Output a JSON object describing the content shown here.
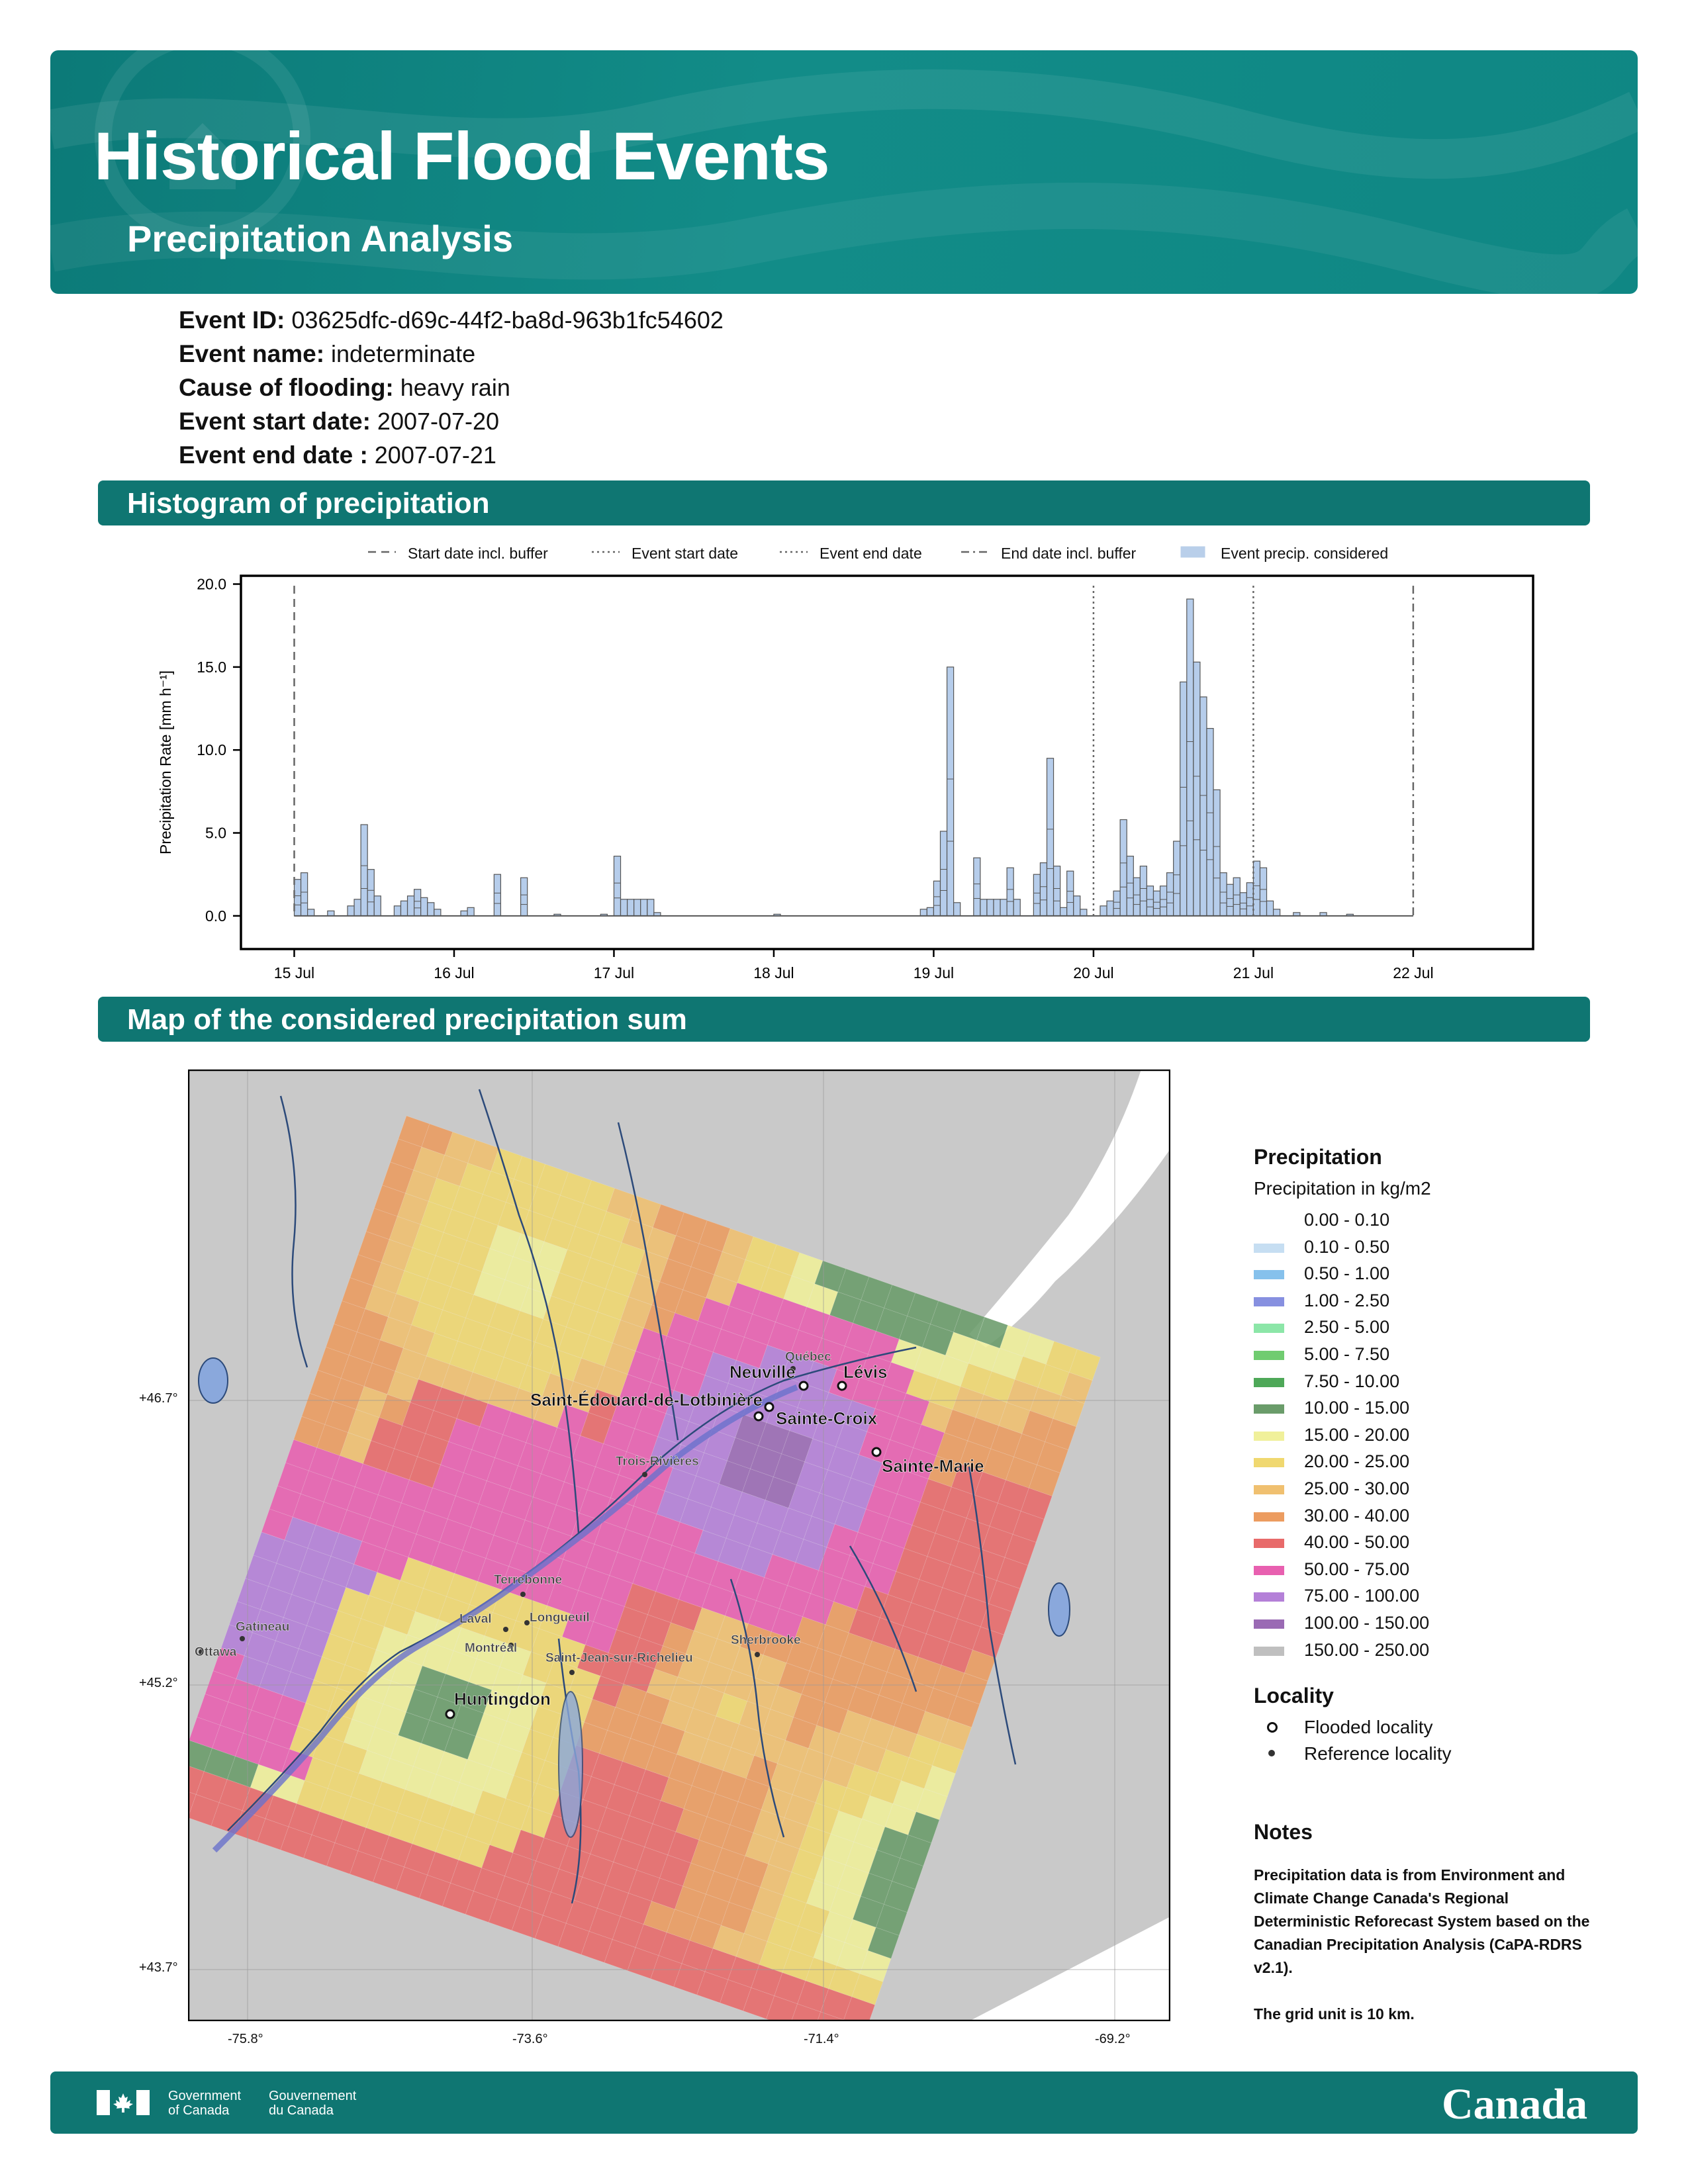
{
  "header": {
    "title": "Historical Flood Events",
    "subtitle": "Precipitation Analysis"
  },
  "event": {
    "id_label": "Event ID:",
    "id": "03625dfc-d69c-44f2-ba8d-963b1fc54602",
    "name_label": "Event name:",
    "name": "indeterminate",
    "cause_label": "Cause of flooding:",
    "cause": "heavy rain",
    "start_label": "Event start date:",
    "start": "2007-07-20",
    "end_label": "Event end date :",
    "end": "2007-07-21"
  },
  "sections": {
    "histogram": "Histogram of precipitation",
    "map": "Map of the considered precipitation sum"
  },
  "chart_data": {
    "type": "bar",
    "ylabel": "Precipitation Rate [mm h⁻¹]",
    "ylim": [
      -2,
      20.5
    ],
    "yticks": [
      "0.0",
      "5.0",
      "10.0",
      "15.0",
      "20.0"
    ],
    "xlim": [
      "2007-07-14T16:00",
      "2007-07-22T18:00"
    ],
    "xticks": [
      {
        "t": "2007-07-15T00:00",
        "label": "15 Jul"
      },
      {
        "t": "2007-07-16T00:00",
        "label": "16 Jul"
      },
      {
        "t": "2007-07-17T00:00",
        "label": "17 Jul"
      },
      {
        "t": "2007-07-18T00:00",
        "label": "18 Jul"
      },
      {
        "t": "2007-07-19T00:00",
        "label": "19 Jul"
      },
      {
        "t": "2007-07-20T00:00",
        "label": "20 Jul"
      },
      {
        "t": "2007-07-21T00:00",
        "label": "21 Jul"
      },
      {
        "t": "2007-07-22T00:00",
        "label": "22 Jul"
      }
    ],
    "legend": {
      "placement": "top",
      "entries": [
        {
          "label": "Start date incl. buffer",
          "style": "dashed"
        },
        {
          "label": "Event start date",
          "style": "dotted"
        },
        {
          "label": "Event end date",
          "style": "dotted"
        },
        {
          "label": "End date incl. buffer",
          "style": "dashdot"
        },
        {
          "label": "Event precip. considered",
          "style": "fill"
        }
      ]
    },
    "vlines": [
      {
        "t": "2007-07-15T00:00",
        "style": "dashed"
      },
      {
        "t": "2007-07-20T00:00",
        "style": "dotted"
      },
      {
        "t": "2007-07-21T00:00",
        "style": "dotted"
      },
      {
        "t": "2007-07-22T00:00",
        "style": "dashdot"
      }
    ],
    "bars": [
      {
        "t": "2007-07-15T00:00",
        "v": 2.2
      },
      {
        "t": "2007-07-15T01:00",
        "v": 2.6
      },
      {
        "t": "2007-07-15T02:00",
        "v": 0.4
      },
      {
        "t": "2007-07-15T05:00",
        "v": 0.3
      },
      {
        "t": "2007-07-15T08:00",
        "v": 0.6
      },
      {
        "t": "2007-07-15T09:00",
        "v": 1.0
      },
      {
        "t": "2007-07-15T10:00",
        "v": 5.5
      },
      {
        "t": "2007-07-15T11:00",
        "v": 2.8
      },
      {
        "t": "2007-07-15T12:00",
        "v": 1.2
      },
      {
        "t": "2007-07-15T15:00",
        "v": 0.6
      },
      {
        "t": "2007-07-15T16:00",
        "v": 0.9
      },
      {
        "t": "2007-07-15T17:00",
        "v": 1.2
      },
      {
        "t": "2007-07-15T18:00",
        "v": 1.6
      },
      {
        "t": "2007-07-15T19:00",
        "v": 1.1
      },
      {
        "t": "2007-07-15T20:00",
        "v": 0.8
      },
      {
        "t": "2007-07-15T21:00",
        "v": 0.4
      },
      {
        "t": "2007-07-16T01:00",
        "v": 0.3
      },
      {
        "t": "2007-07-16T02:00",
        "v": 0.5
      },
      {
        "t": "2007-07-16T06:00",
        "v": 2.5
      },
      {
        "t": "2007-07-16T10:00",
        "v": 2.3
      },
      {
        "t": "2007-07-16T15:00",
        "v": 0.1
      },
      {
        "t": "2007-07-16T22:00",
        "v": 0.1
      },
      {
        "t": "2007-07-17T00:00",
        "v": 3.6
      },
      {
        "t": "2007-07-17T01:00",
        "v": 1.0
      },
      {
        "t": "2007-07-17T02:00",
        "v": 1.0
      },
      {
        "t": "2007-07-17T03:00",
        "v": 1.0
      },
      {
        "t": "2007-07-17T04:00",
        "v": 1.0
      },
      {
        "t": "2007-07-17T05:00",
        "v": 1.0
      },
      {
        "t": "2007-07-17T06:00",
        "v": 0.2
      },
      {
        "t": "2007-07-18T00:00",
        "v": 0.1
      },
      {
        "t": "2007-07-18T22:00",
        "v": 0.4
      },
      {
        "t": "2007-07-18T23:00",
        "v": 0.5
      },
      {
        "t": "2007-07-19T00:00",
        "v": 2.1
      },
      {
        "t": "2007-07-19T01:00",
        "v": 5.1
      },
      {
        "t": "2007-07-19T02:00",
        "v": 15.0
      },
      {
        "t": "2007-07-19T03:00",
        "v": 0.8
      },
      {
        "t": "2007-07-19T06:00",
        "v": 3.5
      },
      {
        "t": "2007-07-19T07:00",
        "v": 1.0
      },
      {
        "t": "2007-07-19T08:00",
        "v": 1.0
      },
      {
        "t": "2007-07-19T09:00",
        "v": 1.0
      },
      {
        "t": "2007-07-19T10:00",
        "v": 1.0
      },
      {
        "t": "2007-07-19T11:00",
        "v": 2.9
      },
      {
        "t": "2007-07-19T12:00",
        "v": 1.0
      },
      {
        "t": "2007-07-19T15:00",
        "v": 2.5
      },
      {
        "t": "2007-07-19T16:00",
        "v": 3.2
      },
      {
        "t": "2007-07-19T17:00",
        "v": 9.5
      },
      {
        "t": "2007-07-19T18:00",
        "v": 3.0
      },
      {
        "t": "2007-07-19T19:00",
        "v": 0.5
      },
      {
        "t": "2007-07-19T20:00",
        "v": 2.7
      },
      {
        "t": "2007-07-19T21:00",
        "v": 1.2
      },
      {
        "t": "2007-07-19T22:00",
        "v": 0.4
      },
      {
        "t": "2007-07-20T01:00",
        "v": 0.6
      },
      {
        "t": "2007-07-20T02:00",
        "v": 0.9
      },
      {
        "t": "2007-07-20T03:00",
        "v": 1.5
      },
      {
        "t": "2007-07-20T04:00",
        "v": 5.8
      },
      {
        "t": "2007-07-20T05:00",
        "v": 3.6
      },
      {
        "t": "2007-07-20T06:00",
        "v": 2.3
      },
      {
        "t": "2007-07-20T07:00",
        "v": 3.0
      },
      {
        "t": "2007-07-20T08:00",
        "v": 1.8
      },
      {
        "t": "2007-07-20T09:00",
        "v": 1.5
      },
      {
        "t": "2007-07-20T10:00",
        "v": 1.8
      },
      {
        "t": "2007-07-20T11:00",
        "v": 2.6
      },
      {
        "t": "2007-07-20T12:00",
        "v": 4.5
      },
      {
        "t": "2007-07-20T13:00",
        "v": 14.1
      },
      {
        "t": "2007-07-20T14:00",
        "v": 19.1
      },
      {
        "t": "2007-07-20T15:00",
        "v": 15.3
      },
      {
        "t": "2007-07-20T16:00",
        "v": 13.2
      },
      {
        "t": "2007-07-20T17:00",
        "v": 11.3
      },
      {
        "t": "2007-07-20T18:00",
        "v": 7.6
      },
      {
        "t": "2007-07-20T19:00",
        "v": 2.6
      },
      {
        "t": "2007-07-20T20:00",
        "v": 1.9
      },
      {
        "t": "2007-07-20T21:00",
        "v": 2.3
      },
      {
        "t": "2007-07-20T22:00",
        "v": 1.4
      },
      {
        "t": "2007-07-20T23:00",
        "v": 2.0
      },
      {
        "t": "2007-07-21T00:00",
        "v": 3.3
      },
      {
        "t": "2007-07-21T01:00",
        "v": 2.9
      },
      {
        "t": "2007-07-21T02:00",
        "v": 0.9
      },
      {
        "t": "2007-07-21T03:00",
        "v": 0.4
      },
      {
        "t": "2007-07-21T06:00",
        "v": 0.2
      },
      {
        "t": "2007-07-21T10:00",
        "v": 0.2
      },
      {
        "t": "2007-07-21T14:00",
        "v": 0.1
      }
    ]
  },
  "map": {
    "lat_ticks": [
      "+46.7°",
      "+45.2°",
      "+43.7°"
    ],
    "lon_ticks": [
      "-75.8°",
      "-73.6°",
      "-71.4°",
      "-69.2°"
    ],
    "flooded": [
      "Neuville",
      "Lévis",
      "Saint-Édouard-de-Lotbinière",
      "Sainte-Croix",
      "Sainte-Marie",
      "Huntingdon"
    ],
    "reference": [
      "Québec",
      "Trois-Rivières",
      "Terrebonne",
      "Laval",
      "Longueuil",
      "Montréal",
      "Gatineau",
      "Ottawa",
      "Saint-Jean-sur-Richelieu",
      "Sherbrooke"
    ],
    "colors": {
      "land": "#c9c9c9",
      "water": "#ffffff",
      "lake": "#8aa8dc",
      "river": "#2c4a7a"
    }
  },
  "legend": {
    "precip_title": "Precipitation",
    "precip_sub": "Precipitation in kg/m2",
    "classes": [
      {
        "label": "0.00 - 0.10",
        "color": "#ffffff"
      },
      {
        "label": "0.10 - 0.50",
        "color": "#c6def2"
      },
      {
        "label": "0.50 - 1.00",
        "color": "#86c1ec"
      },
      {
        "label": "1.00 - 2.50",
        "color": "#8790e0"
      },
      {
        "label": "2.50 - 5.00",
        "color": "#8ce6a8"
      },
      {
        "label": "5.00 - 7.50",
        "color": "#70cc70"
      },
      {
        "label": "7.50 - 10.00",
        "color": "#4ea858"
      },
      {
        "label": "10.00 - 15.00",
        "color": "#6a9c6a"
      },
      {
        "label": "15.00 - 20.00",
        "color": "#f0f09a"
      },
      {
        "label": "20.00 - 25.00",
        "color": "#f0d870"
      },
      {
        "label": "25.00 - 30.00",
        "color": "#f0c070"
      },
      {
        "label": "30.00 - 40.00",
        "color": "#ec9c60"
      },
      {
        "label": "40.00 - 50.00",
        "color": "#e86a6a"
      },
      {
        "label": "50.00 - 75.00",
        "color": "#e860b0"
      },
      {
        "label": "75.00 - 100.00",
        "color": "#b480d8"
      },
      {
        "label": "100.00 - 150.00",
        "color": "#9a6ab4"
      },
      {
        "label": "150.00 - 250.00",
        "color": "#bfbfbf"
      }
    ],
    "locality_title": "Locality",
    "flooded_label": "Flooded locality",
    "reference_label": "Reference locality",
    "notes_title": "Notes",
    "notes_text": "Precipitation data is from Environment and Climate Change Canada's Regional Deterministic Reforecast System based on the Canadian Precipitation Analysis (CaPA-RDRS v2.1).",
    "notes_grid": "The grid unit is 10 km."
  },
  "footer": {
    "gov_en": "Government\nof Canada",
    "gov_fr": "Gouvernement\ndu Canada",
    "wordmark": "Canada"
  }
}
